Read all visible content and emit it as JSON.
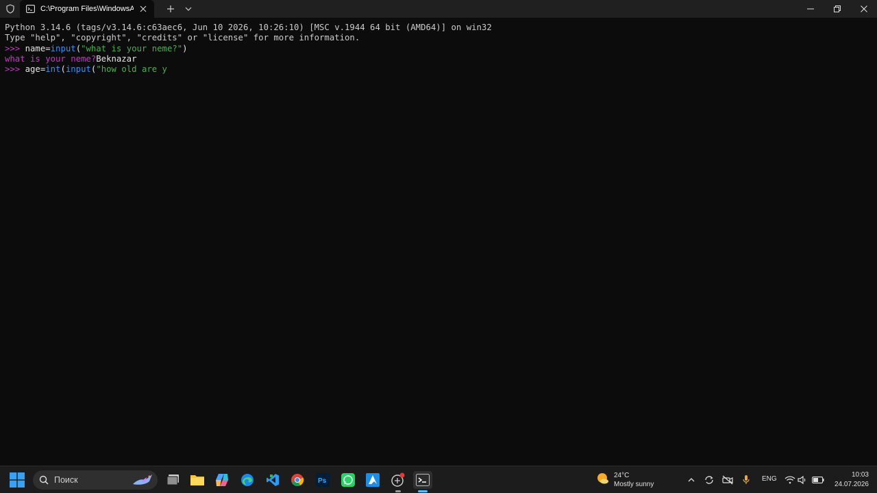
{
  "window": {
    "tab_title": "C:\\Program Files\\WindowsApps"
  },
  "terminal": {
    "line1": "Python 3.14.6 (tags/v3.14.6:c63aec6, Jun 10 2026, 10:26:10) [MSC v.1944 64 bit (AMD64)] on win32",
    "line2": "Type \"help\", \"copyright\", \"credits\" or \"license\" for more information.",
    "line3": {
      "prompt": ">>> ",
      "code": "name=",
      "func": "input",
      "paren": "(",
      "str": "\"what is your neme?\"",
      "close": ")"
    },
    "line4": {
      "prompt_text": "what is your neme?",
      "input": "Beknazar"
    },
    "line5": {
      "prompt": ">>> ",
      "code": "age=",
      "func1": "int",
      "paren1": "(",
      "func2": "input",
      "paren2": "(",
      "str": "\"how old are y"
    }
  },
  "taskbar": {
    "search_placeholder": "Поиск",
    "weather_temp": "24°C",
    "weather_desc": "Mostly sunny",
    "language": "ENG",
    "time": "10:03",
    "date": "24.07.2026",
    "apps": [
      "task-view",
      "file-explorer",
      "copilot",
      "edge",
      "vscode",
      "chrome",
      "photoshop",
      "whatsapp",
      "azure-data-studio",
      "python-idle",
      "terminal"
    ]
  },
  "colors": {
    "terminal_bg": "#0c0c0c",
    "prompt": "#c837c8",
    "function": "#3b8eea",
    "string": "#4caf50",
    "taskbar_bg": "#1c1c1c"
  }
}
